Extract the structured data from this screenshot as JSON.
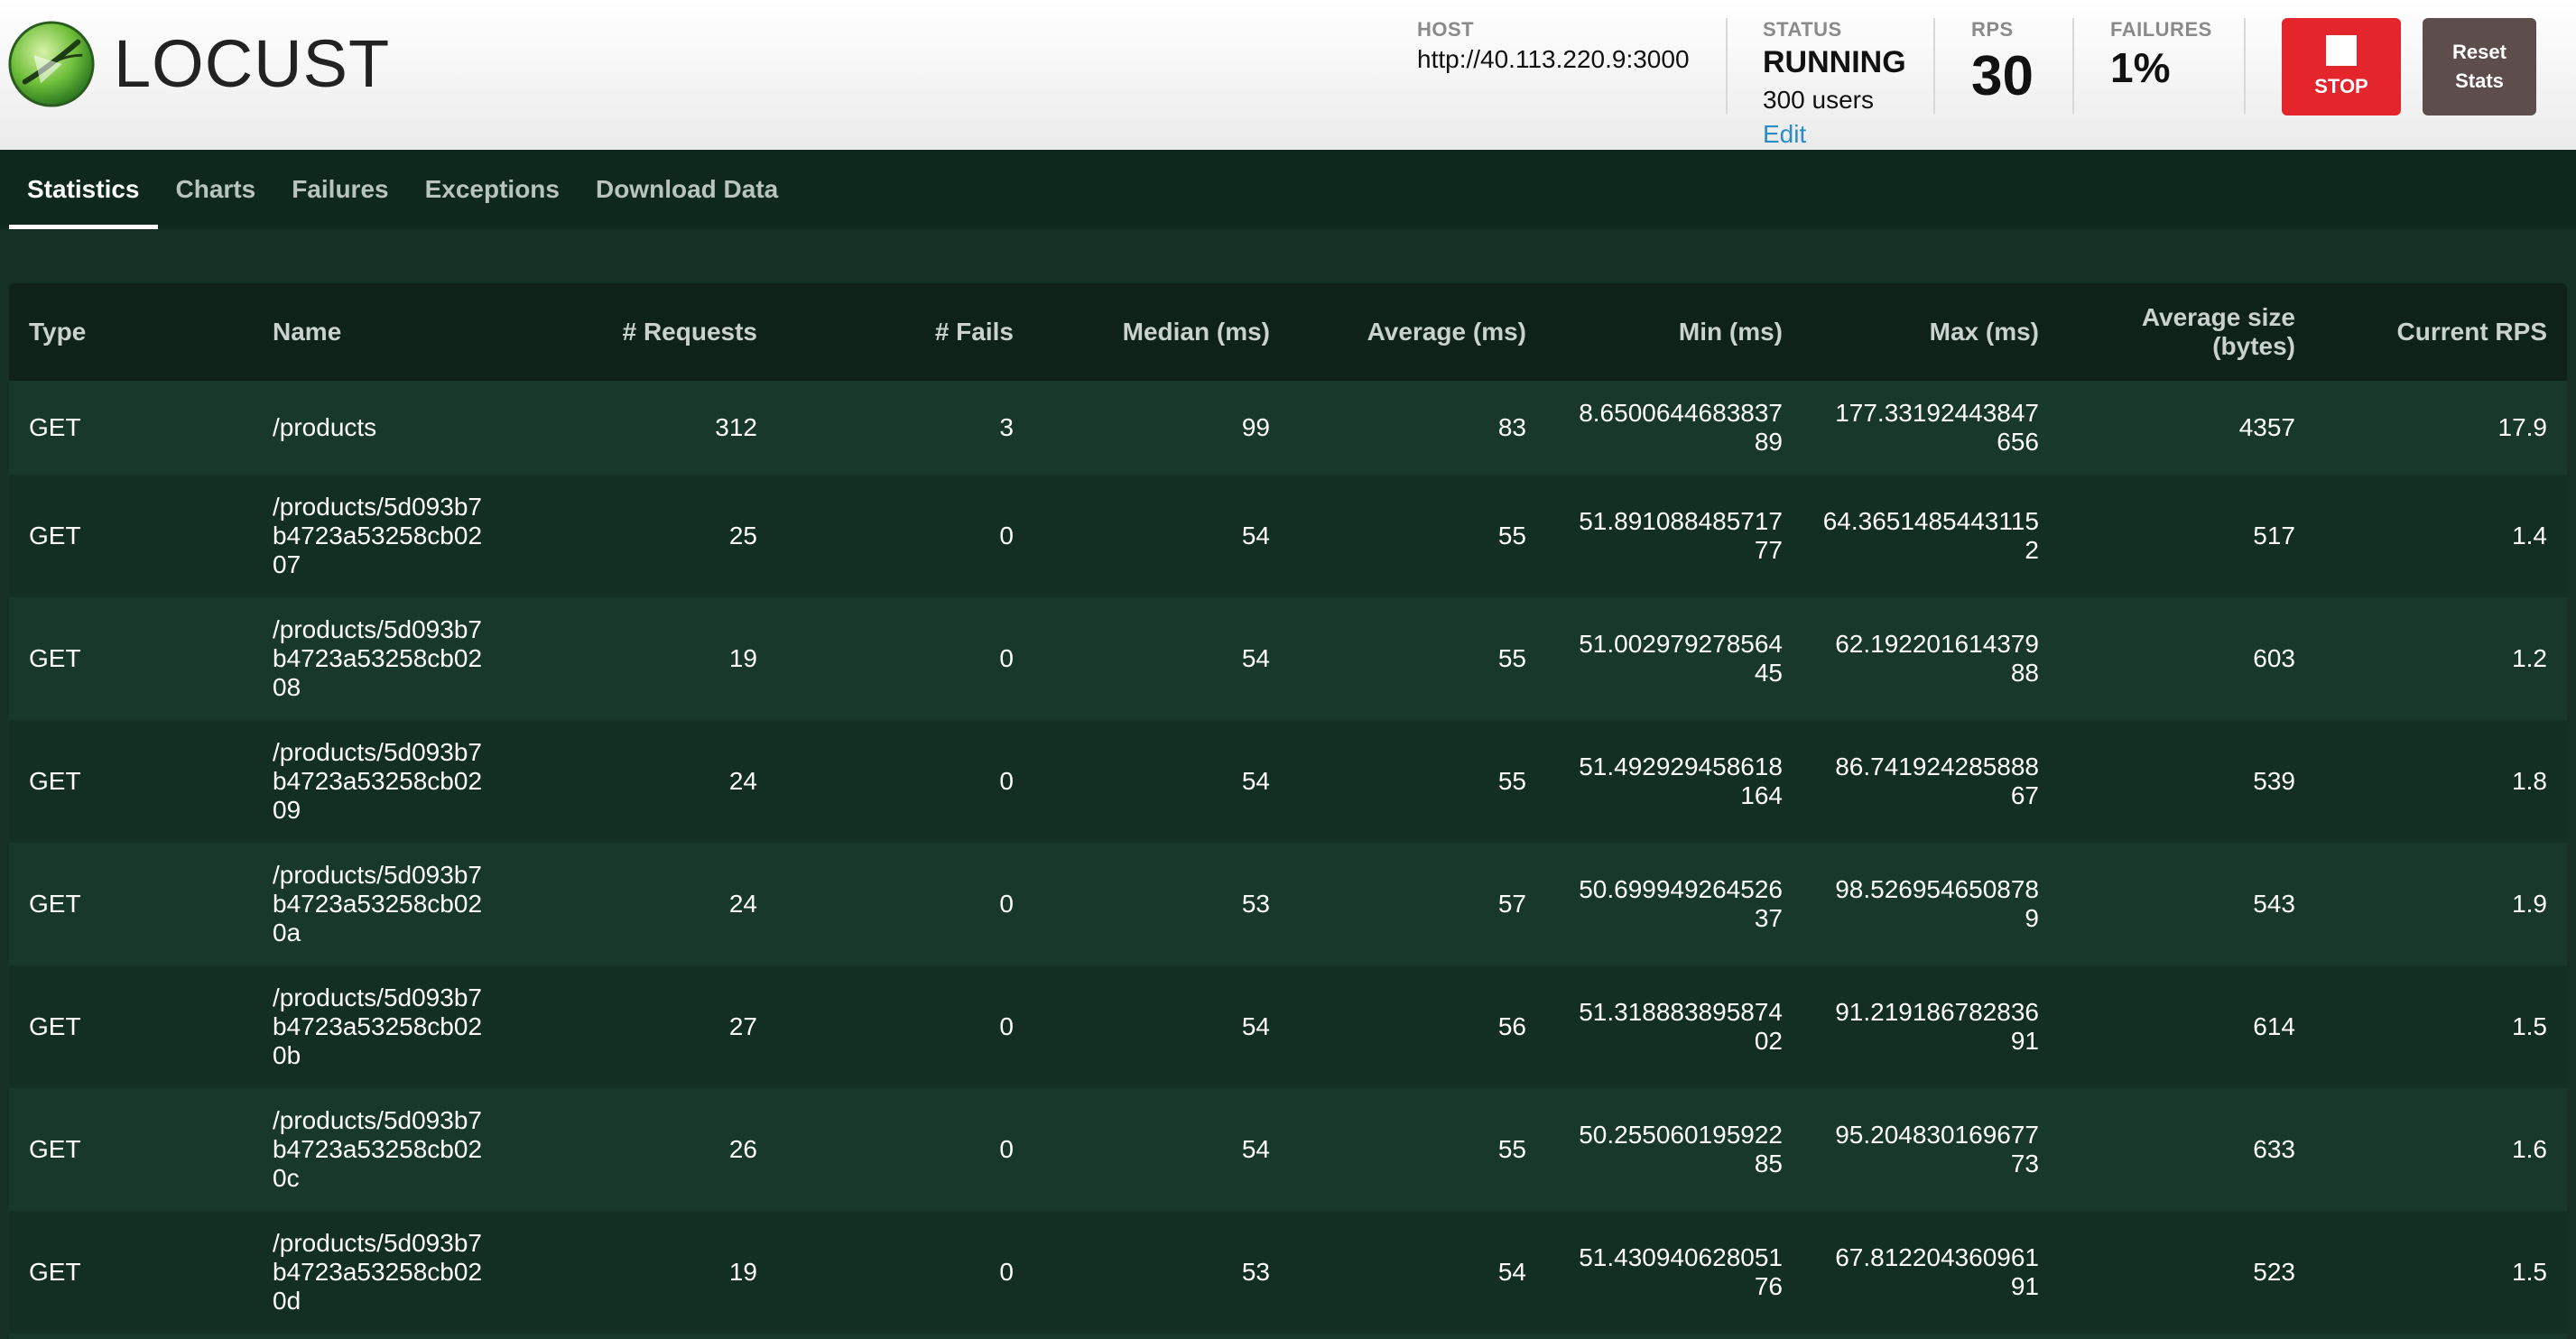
{
  "header": {
    "logo_text": "LOCUST",
    "host_label": "HOST",
    "host_value": "http://40.113.220.9:3000",
    "status_label": "STATUS",
    "status_value": "RUNNING",
    "users_value": "300 users",
    "edit_label": "Edit",
    "rps_label": "RPS",
    "rps_value": "30",
    "failures_label": "FAILURES",
    "failures_value": "1%",
    "stop_label": "STOP",
    "reset_label_1": "Reset",
    "reset_label_2": "Stats"
  },
  "tabs": [
    {
      "label": "Statistics",
      "active": true
    },
    {
      "label": "Charts"
    },
    {
      "label": "Failures"
    },
    {
      "label": "Exceptions"
    },
    {
      "label": "Download Data"
    }
  ],
  "table": {
    "columns": {
      "type": "Type",
      "name": "Name",
      "requests": "# Requests",
      "fails": "# Fails",
      "median": "Median (ms)",
      "average": "Average (ms)",
      "min": "Min (ms)",
      "max": "Max (ms)",
      "avg_size": "Average size (bytes)",
      "rps": "Current RPS"
    },
    "rows": [
      {
        "type": "GET",
        "name": "/products",
        "requests": "312",
        "fails": "3",
        "median": "99",
        "average": "83",
        "min": "8.650064468383789",
        "max": "177.33192443847656",
        "avg_size": "4357",
        "rps": "17.9"
      },
      {
        "type": "GET",
        "name": "/products/5d093b7b4723a53258cb0207",
        "requests": "25",
        "fails": "0",
        "median": "54",
        "average": "55",
        "min": "51.89108848571777",
        "max": "64.36514854431152",
        "avg_size": "517",
        "rps": "1.4"
      },
      {
        "type": "GET",
        "name": "/products/5d093b7b4723a53258cb0208",
        "requests": "19",
        "fails": "0",
        "median": "54",
        "average": "55",
        "min": "51.00297927856445",
        "max": "62.19220161437988",
        "avg_size": "603",
        "rps": "1.2"
      },
      {
        "type": "GET",
        "name": "/products/5d093b7b4723a53258cb0209",
        "requests": "24",
        "fails": "0",
        "median": "54",
        "average": "55",
        "min": "51.492929458618164",
        "max": "86.74192428588867",
        "avg_size": "539",
        "rps": "1.8"
      },
      {
        "type": "GET",
        "name": "/products/5d093b7b4723a53258cb020a",
        "requests": "24",
        "fails": "0",
        "median": "53",
        "average": "57",
        "min": "50.69994926452637",
        "max": "98.5269546508789",
        "avg_size": "543",
        "rps": "1.9"
      },
      {
        "type": "GET",
        "name": "/products/5d093b7b4723a53258cb020b",
        "requests": "27",
        "fails": "0",
        "median": "54",
        "average": "56",
        "min": "51.31888389587402",
        "max": "91.21918678283691",
        "avg_size": "614",
        "rps": "1.5"
      },
      {
        "type": "GET",
        "name": "/products/5d093b7b4723a53258cb020c",
        "requests": "26",
        "fails": "0",
        "median": "54",
        "average": "55",
        "min": "50.25506019592285",
        "max": "95.20483016967773",
        "avg_size": "633",
        "rps": "1.6"
      },
      {
        "type": "GET",
        "name": "/products/5d093b7b4723a53258cb020d",
        "requests": "19",
        "fails": "0",
        "median": "53",
        "average": "54",
        "min": "51.43094062805176",
        "max": "67.81220436096191",
        "avg_size": "523",
        "rps": "1.5"
      }
    ]
  }
}
